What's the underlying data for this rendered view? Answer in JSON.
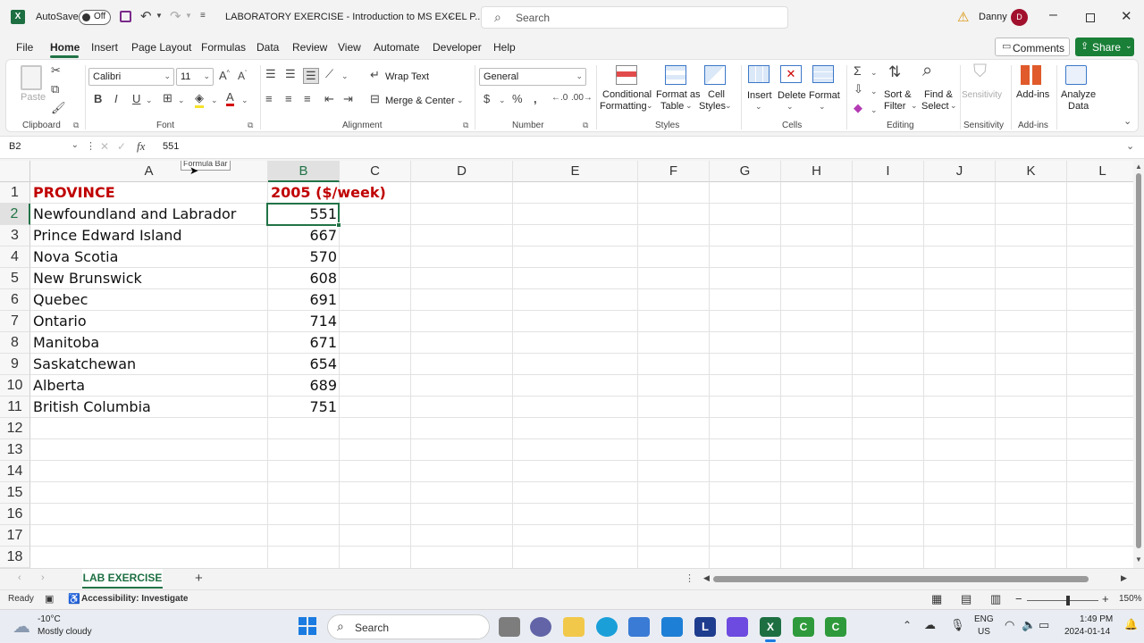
{
  "titlebar": {
    "autosave_label": "AutoSave",
    "autosave_state": "Off",
    "doc_title": "LABORATORY EXERCISE - Introduction to MS EXCEL P...",
    "search_placeholder": "Search",
    "user_name": "Danny",
    "user_initial": "D"
  },
  "menu": {
    "items": [
      "File",
      "Home",
      "Insert",
      "Page Layout",
      "Formulas",
      "Data",
      "Review",
      "View",
      "Automate",
      "Developer",
      "Help"
    ],
    "active": "Home",
    "comments_label": "Comments",
    "share_label": "Share"
  },
  "ribbon": {
    "clipboard": {
      "paste": "Paste",
      "label": "Clipboard"
    },
    "font": {
      "name": "Calibri",
      "size": "11",
      "bold": "B",
      "italic": "I",
      "underline": "U",
      "label": "Font"
    },
    "alignment": {
      "wrap": "Wrap Text",
      "merge": "Merge & Center",
      "label": "Alignment"
    },
    "number": {
      "format": "General",
      "label": "Number"
    },
    "styles": {
      "cond_1": "Conditional",
      "cond_2": "Formatting",
      "fmt_table_1": "Format as",
      "fmt_table_2": "Table",
      "cell_styles_1": "Cell",
      "cell_styles_2": "Styles",
      "label": "Styles"
    },
    "cells": {
      "insert": "Insert",
      "delete": "Delete",
      "format": "Format",
      "label": "Cells"
    },
    "editing": {
      "sort_1": "Sort &",
      "sort_2": "Filter",
      "find_1": "Find &",
      "find_2": "Select",
      "label": "Editing"
    },
    "sensitivity": {
      "btn": "Sensitivity",
      "label": "Sensitivity"
    },
    "addins": {
      "btn": "Add-ins",
      "label": "Add-ins"
    },
    "analyze": {
      "btn_1": "Analyze",
      "btn_2": "Data"
    }
  },
  "formula_bar": {
    "name_box": "B2",
    "fx": "fx",
    "value": "551",
    "tooltip": "Formula Bar"
  },
  "sheet": {
    "columns": [
      "A",
      "B",
      "C",
      "D",
      "E",
      "F",
      "G",
      "H",
      "I",
      "J",
      "K",
      "L"
    ],
    "row_numbers": [
      "1",
      "2",
      "3",
      "4",
      "5",
      "6",
      "7",
      "8",
      "9",
      "10",
      "11",
      "12",
      "13",
      "14",
      "15",
      "16",
      "17",
      "18"
    ],
    "header": {
      "province": "PROVINCE",
      "value": "2005 ($/week)"
    },
    "rows": [
      {
        "province": "Newfoundland and Labrador",
        "value": "551"
      },
      {
        "province": "Prince Edward Island",
        "value": "667"
      },
      {
        "province": "Nova Scotia",
        "value": "570"
      },
      {
        "province": "New Brunswick",
        "value": "608"
      },
      {
        "province": "Quebec",
        "value": "691"
      },
      {
        "province": "Ontario",
        "value": "714"
      },
      {
        "province": "Manitoba",
        "value": "671"
      },
      {
        "province": "Saskatchewan",
        "value": "654"
      },
      {
        "province": "Alberta",
        "value": "689"
      },
      {
        "province": "British Columbia",
        "value": "751"
      }
    ],
    "selected_cell": "B2"
  },
  "sheet_tabs": {
    "active": "LAB EXERCISE",
    "add": "+"
  },
  "status": {
    "ready": "Ready",
    "accessibility": "Accessibility: Investigate",
    "zoom": "150%"
  },
  "taskbar": {
    "temp": "-10°C",
    "weather": "Mostly cloudy",
    "search_placeholder": "Search",
    "lang_1": "ENG",
    "lang_2": "US",
    "time": "1:49 PM",
    "date": "2024-01-14"
  },
  "colors": {
    "accent": "#217346",
    "header_red": "#c00000",
    "share_green": "#1a7f37"
  }
}
